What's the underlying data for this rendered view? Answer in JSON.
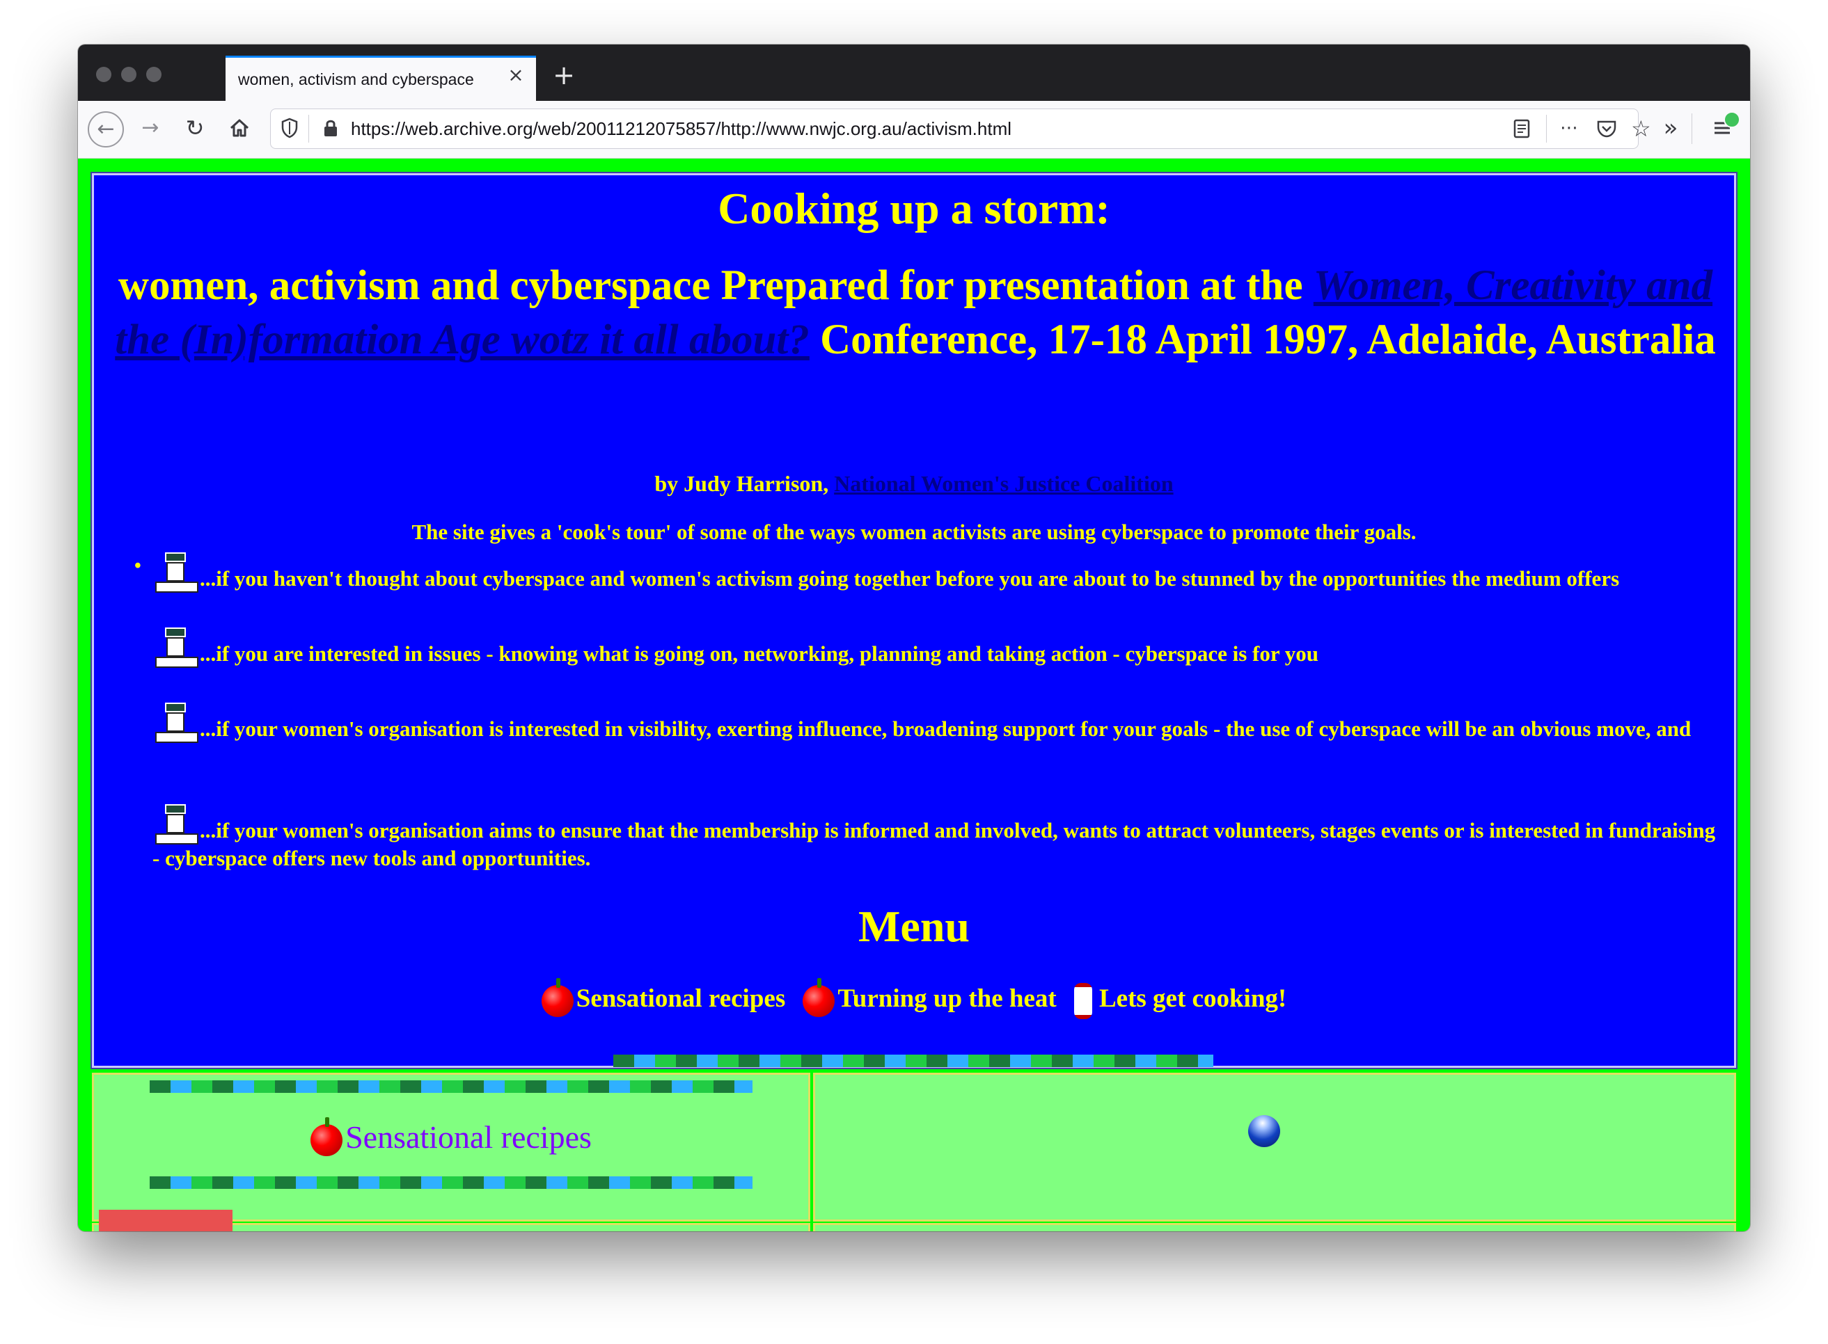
{
  "browser": {
    "tab_title": "women, activism and cyberspace",
    "tab_close_icon": "×",
    "new_tab_icon": "+",
    "url": "https://web.archive.org/web/20011212075857/http://www.nwjc.org.au/activism.html"
  },
  "page": {
    "title": "Cooking up a storm:",
    "subtitle_prefix": "women, activism and cyberspace Prepared for presentation at the ",
    "conference_link": "Women, Creativity and the (In)formation Age wotz it all about?",
    "subtitle_suffix": " Conference, 17-18 April 1997, Adelaide, Australia",
    "byline_prefix": "by Judy Harrison, ",
    "byline_link": "National Women's Justice Coalition",
    "intro": "The site gives a 'cook's tour' of some of the ways women activists are using cyberspace to promote their goals.",
    "points": [
      "...if you haven't thought about cyberspace and women's activism going together before you are about to be stunned by the opportunities the medium offers",
      "...if you are interested in issues - knowing what is going on, networking, planning and taking action - cyberspace is for you",
      "...if your women's organisation is interested in visibility, exerting influence, broadening support for your goals - the use of cyberspace will be an obvious move, and",
      "...if your women's organisation aims to ensure that the membership is informed and involved, wants to attract volunteers, stages events or is interested in fundraising - cyberspace offers new tools and opportunities."
    ],
    "menu_heading": "Menu",
    "menu_items": [
      "Sensational recipes",
      "Turning up the heat",
      "Lets get cooking!"
    ],
    "section_heading": "Sensational recipes"
  },
  "colors": {
    "page_background": "#00ff00",
    "panel_background": "#0000ff",
    "text": "#ffff00",
    "link": "#00008b",
    "table_cell": "#80ff80",
    "section_heading": "#7f00ff"
  }
}
